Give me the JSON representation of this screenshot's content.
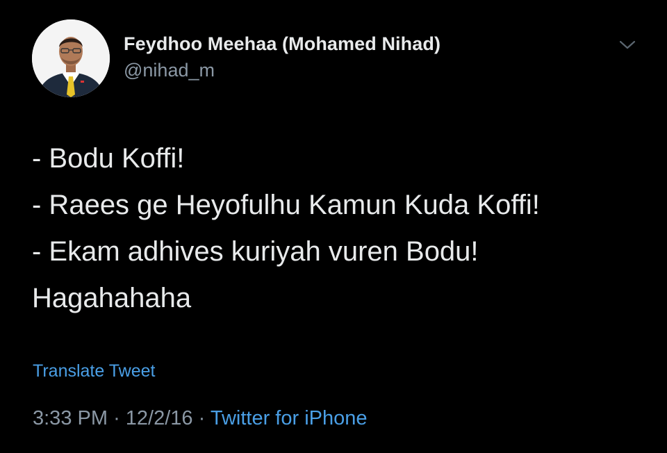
{
  "colors": {
    "background": "#000000",
    "primary_text": "#e8eaeb",
    "secondary_text": "#8b98a5",
    "link": "#4a9fe6"
  },
  "author": {
    "display_name": "Feydhoo Meehaa (Mohamed Nihad)",
    "handle": "@nihad_m",
    "avatar_icon": "profile-photo-avatar"
  },
  "menu": {
    "icon": "chevron-down-icon"
  },
  "tweet": {
    "lines": [
      "- Bodu Koffi!",
      "- Raees ge Heyofulhu Kamun Kuda Koffi!",
      "- Ekam adhives kuriyah vuren Bodu!",
      "Hagahahaha"
    ],
    "translate_label": "Translate Tweet"
  },
  "meta": {
    "time": "3:33 PM",
    "separator": "·",
    "date": "12/2/16",
    "source": "Twitter for iPhone"
  }
}
